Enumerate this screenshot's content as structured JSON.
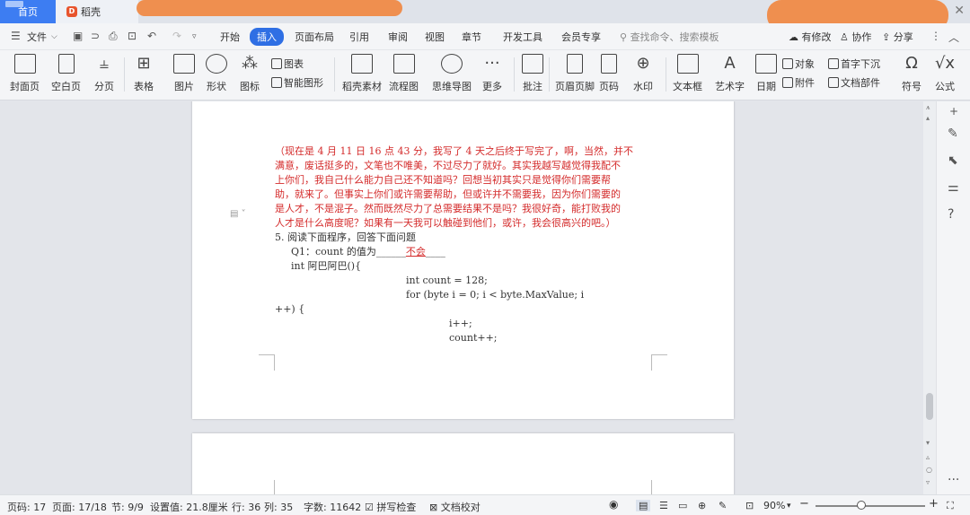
{
  "titlebar": {
    "tab_home": "首页",
    "tab_doc": "稻壳",
    "close": "✕"
  },
  "menubar": {
    "file": "文件",
    "items": [
      "开始",
      "插入",
      "页面布局",
      "引用",
      "审阅",
      "视图",
      "章节",
      "开发工具",
      "会员专享"
    ],
    "active_index": 1,
    "search_placeholder": "查找命令、搜索模板",
    "right": [
      "有修改",
      "协作",
      "分享"
    ]
  },
  "ribbon": {
    "cover": "封面页",
    "blank": "空白页",
    "pagebreak": "分页",
    "table": "表格",
    "picture": "图片",
    "shape": "形状",
    "icon": "图标",
    "chart": "图表",
    "smartart": "智能图形",
    "docer": "稻壳素材",
    "flowchart": "流程图",
    "mindmap": "思维导图",
    "more": "更多",
    "comment": "批注",
    "headerfooter": "页眉页脚",
    "pagenum": "页码",
    "watermark": "水印",
    "textbox": "文本框",
    "wordart": "艺术字",
    "date": "日期",
    "object": "对象",
    "attachment": "附件",
    "dropcap": "首字下沉",
    "docpart": "文档部件",
    "symbol": "符号",
    "formula": "公式"
  },
  "document": {
    "red_lines": [
      "（现在是 4 月 11 日 16 点 43 分，我写了 4 天之后终于写完了，啊，当然，并不",
      "满意，废话挺多的，文笔也不唯美，不过尽力了就好。其实我越写越觉得我配不",
      "上你们，我自己什么能力自己还不知道吗？回想当初其实只是觉得你们需要帮",
      "助，就来了。但事实上你们或许需要帮助，但或许并不需要我，因为你们需要的",
      "是人才，不是混子。然而既然尽力了总需要结果不是吗？我很好奇，能打败我的",
      "人才是什么高度呢？如果有一天我可以触碰到他们，或许，我会很高兴的吧。）"
    ],
    "q_title": "5.  阅读下面程序，回答下面问题",
    "q1_prefix": "Q1：count 的值为______",
    "q1_answer": "不会",
    "q1_suffix": "____",
    "code_func": "int   阿巴阿巴(){",
    "code_count": "int   count   =   128;",
    "code_for": "for   (byte   i   =   0;   i   <   byte.MaxValue;   i",
    "code_for_cont": "++)   {",
    "code_inc_i": "i++;",
    "code_inc_count": "count++;"
  },
  "statusbar": {
    "page": "页码: 17",
    "pages": "页面: 17/18",
    "section": "节: 9/9",
    "setting": "设置值: 21.8厘米",
    "row": "行: 36",
    "col": "列: 35",
    "words": "字数: 11642",
    "spellcheck": "拼写检查",
    "doccheck": "文档校对",
    "zoom": "90%"
  }
}
